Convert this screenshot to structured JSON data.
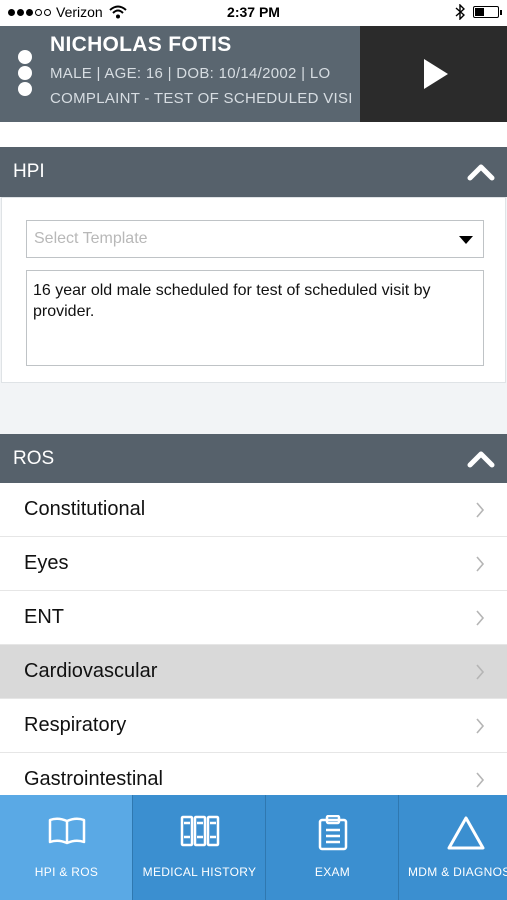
{
  "status_bar": {
    "carrier": "Verizon",
    "time": "2:37 PM"
  },
  "patient": {
    "name": "NICHOLAS FOTIS",
    "details": "MALE | AGE: 16 | DOB: 10/14/2002 | LO",
    "complaint": "COMPLAINT - TEST OF SCHEDULED VISI"
  },
  "hpi": {
    "title": "HPI",
    "template_placeholder": "Select Template",
    "note": "16 year old male scheduled for test of scheduled visit by provider."
  },
  "ros": {
    "title": "ROS",
    "items": [
      {
        "label": "Constitutional",
        "selected": false
      },
      {
        "label": "Eyes",
        "selected": false
      },
      {
        "label": "ENT",
        "selected": false
      },
      {
        "label": "Cardiovascular",
        "selected": true
      },
      {
        "label": "Respiratory",
        "selected": false
      },
      {
        "label": "Gastrointestinal",
        "selected": false
      }
    ]
  },
  "tabs": [
    {
      "label": "HPI & ROS",
      "icon": "book-icon",
      "active": true
    },
    {
      "label": "MEDICAL HISTORY",
      "icon": "binders-icon",
      "active": false
    },
    {
      "label": "EXAM",
      "icon": "clipboard-icon",
      "active": false
    },
    {
      "label": "MDM & DIAGNOS",
      "icon": "triangle-icon",
      "active": false
    }
  ],
  "colors": {
    "header": "#56616b",
    "tab_bar": "#3b8fd0",
    "tab_active": "#5aa9e5",
    "selected_row": "#d9d9d9"
  }
}
